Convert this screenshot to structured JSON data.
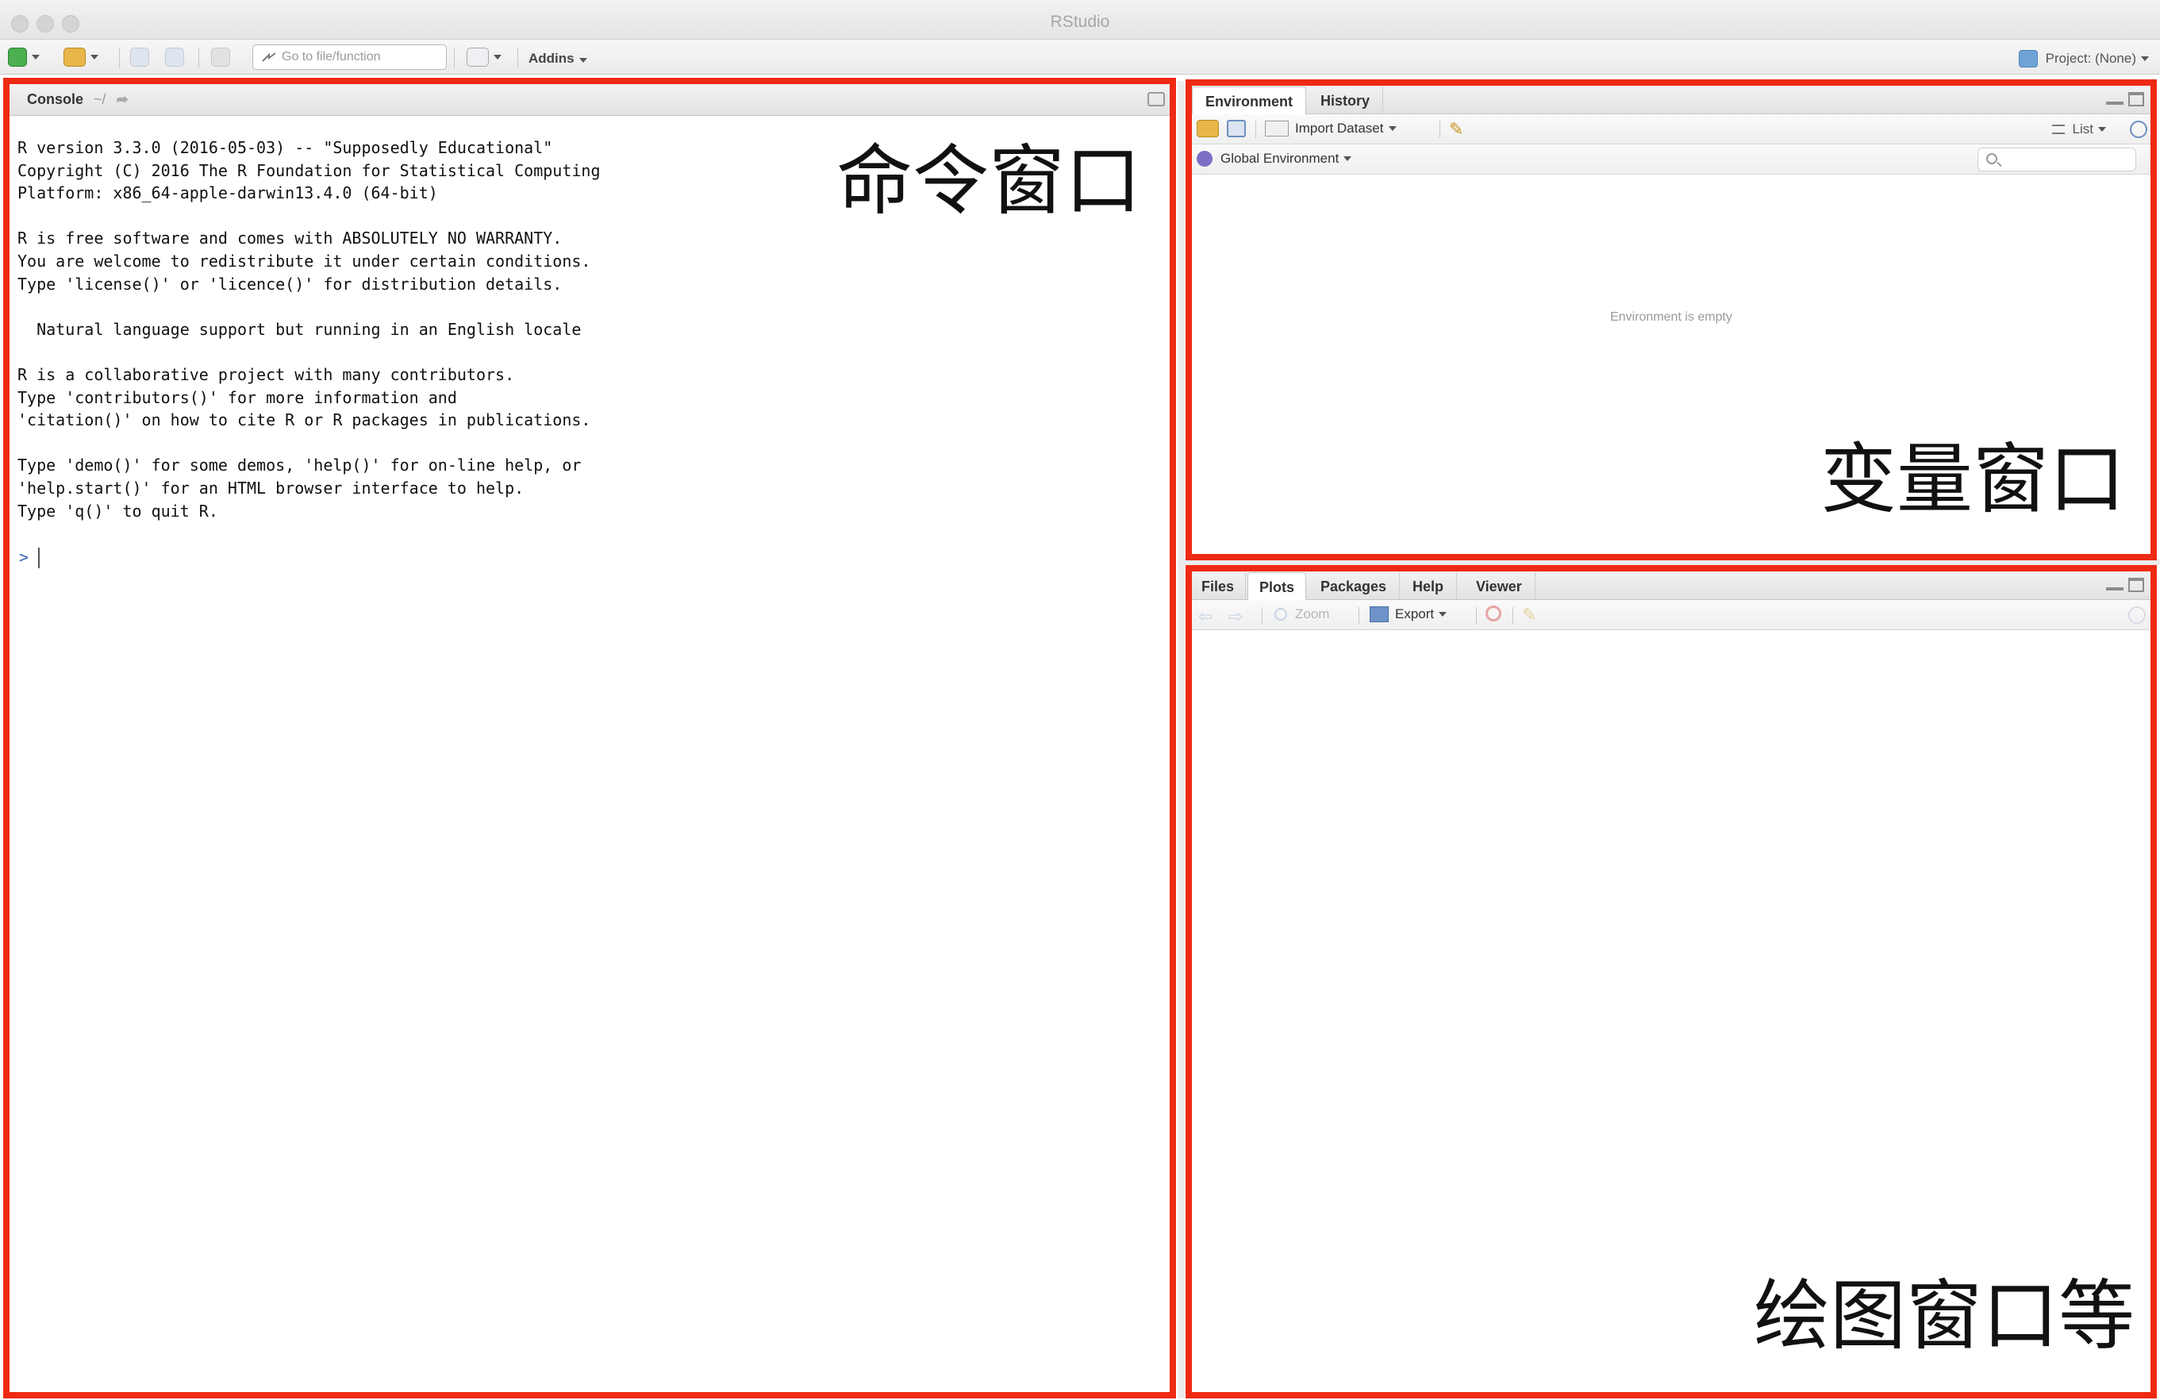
{
  "window": {
    "title": "RStudio"
  },
  "toolbar": {
    "goto_placeholder": "Go to file/function",
    "addins_label": "Addins",
    "project_label": "Project: (None)"
  },
  "console": {
    "tab_label": "Console",
    "path": "~/",
    "lines": [
      "R version 3.3.0 (2016-05-03) -- \"Supposedly Educational\"",
      "Copyright (C) 2016 The R Foundation for Statistical Computing",
      "Platform: x86_64-apple-darwin13.4.0 (64-bit)",
      "",
      "R is free software and comes with ABSOLUTELY NO WARRANTY.",
      "You are welcome to redistribute it under certain conditions.",
      "Type 'license()' or 'licence()' for distribution details.",
      "",
      "  Natural language support but running in an English locale",
      "",
      "R is a collaborative project with many contributors.",
      "Type 'contributors()' for more information and",
      "'citation()' on how to cite R or R packages in publications.",
      "",
      "Type 'demo()' for some demos, 'help()' for on-line help, or",
      "'help.start()' for an HTML browser interface to help.",
      "Type 'q()' to quit R."
    ],
    "prompt": ">"
  },
  "environment": {
    "tabs": [
      "Environment",
      "History"
    ],
    "import_dataset_label": "Import Dataset",
    "list_label": "List",
    "scope_label": "Global Environment",
    "empty_message": "Environment is empty"
  },
  "files_pane": {
    "tabs": [
      "Files",
      "Plots",
      "Packages",
      "Help",
      "Viewer"
    ],
    "zoom_label": "Zoom",
    "export_label": "Export"
  },
  "annotations": {
    "console_label": "命令窗口",
    "env_label": "变量窗口",
    "plots_label": "绘图窗口等"
  },
  "colors": {
    "annotation_border": "#ee2a14"
  }
}
